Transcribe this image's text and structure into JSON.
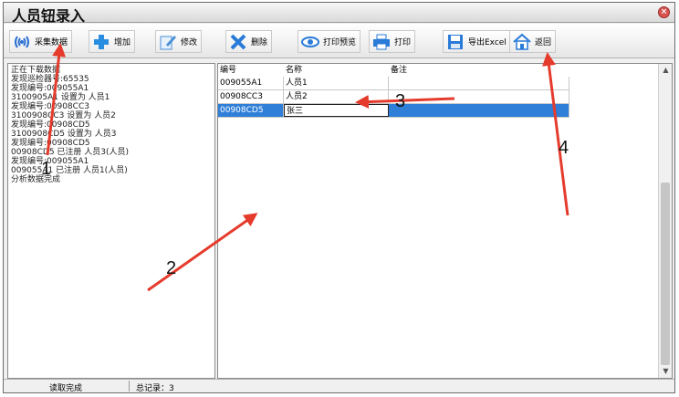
{
  "window": {
    "title": "人员钮录入"
  },
  "toolbar": {
    "collect": "采集数据",
    "add": "增加",
    "edit": "修改",
    "delete": "删除",
    "preview": "打印预览",
    "print": "打印",
    "export": "导出Excel",
    "back": "返回"
  },
  "log": {
    "lines": [
      "正在下载数据",
      "发现巡检器号:65535",
      "发现编号:009055A1",
      "3100905A1 设置为 人员1",
      "发现编号:00908CC3",
      "3100908CC3 设置为 人员2",
      "发现编号:00908CD5",
      "3100908CD5 设置为 人员3",
      "发现编号:00908CD5",
      "00908CD5 已注册 人员3(人员)",
      "发现编号:009055A1",
      "009055A1 已注册 人员1(人员)",
      "分析数据完成"
    ]
  },
  "grid": {
    "headers": [
      "编号",
      "名称",
      "备注"
    ],
    "rows": [
      {
        "id": "009055A1",
        "name": "人员1",
        "note": ""
      },
      {
        "id": "00908CC3",
        "name": "人员2",
        "note": ""
      },
      {
        "id": "00908CD5",
        "name": "张三",
        "note": ""
      }
    ]
  },
  "status": {
    "read": "读取完成",
    "total": "总记录：3"
  },
  "annotations": [
    "1",
    "2",
    "3",
    "4"
  ],
  "colors": {
    "arrow": "#e53b2c",
    "selection": "#2f7fd9"
  }
}
